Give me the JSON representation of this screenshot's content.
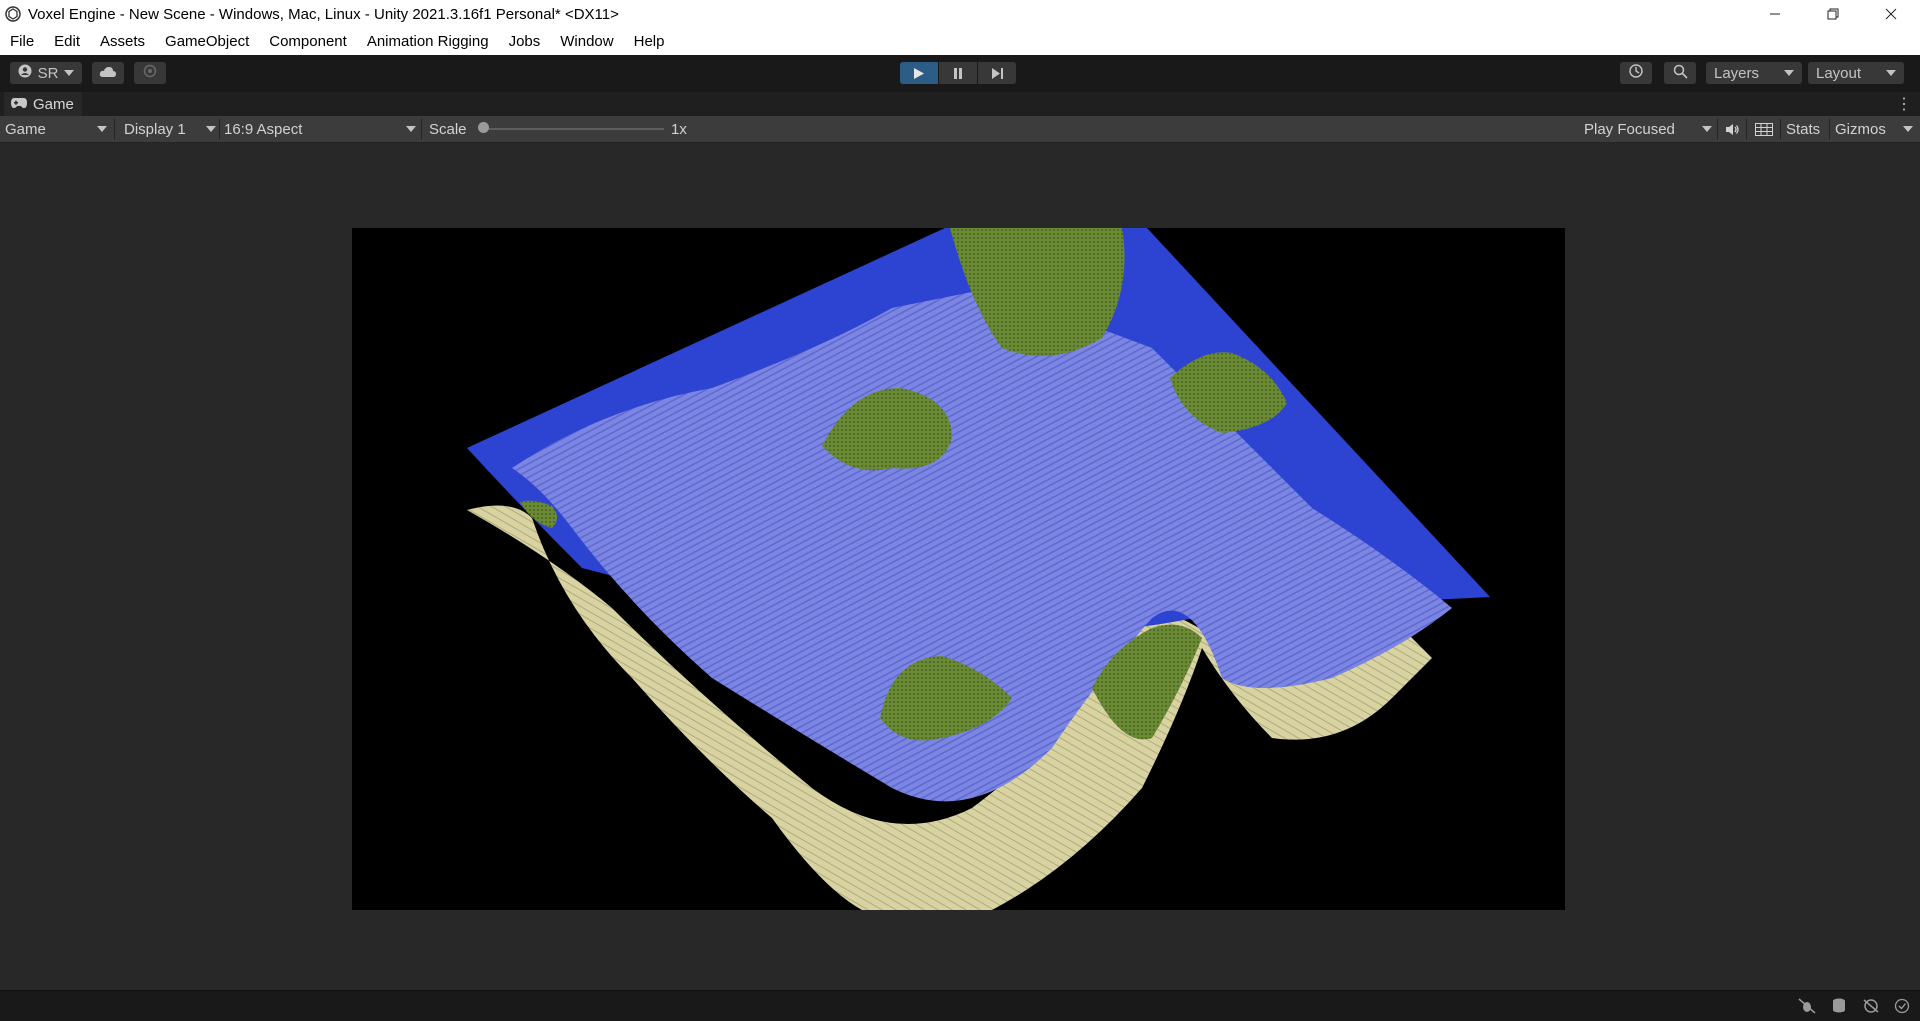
{
  "window": {
    "title": "Voxel Engine - New Scene - Windows, Mac, Linux - Unity 2021.3.16f1 Personal* <DX11>",
    "controls": [
      "minimize-icon",
      "restore-icon",
      "close-icon"
    ]
  },
  "menu": [
    "File",
    "Edit",
    "Assets",
    "GameObject",
    "Component",
    "Animation Rigging",
    "Jobs",
    "Window",
    "Help"
  ],
  "toolbar": {
    "account_label": "SR",
    "layers_label": "Layers",
    "layout_label": "Layout",
    "play_active": true,
    "accent": "#2c5d87"
  },
  "tab": {
    "label": "Game"
  },
  "gamebar": {
    "mode": "Game",
    "display": "Display 1",
    "aspect": "16:9 Aspect",
    "scale_label": "Scale",
    "scale_value": "1x",
    "scale_fraction": 0,
    "play_focused": "Play Focused",
    "stats": "Stats",
    "gizmos": "Gizmos"
  },
  "scene_colors": {
    "water": "#2d44d2",
    "terrain_sand": "#d8d3a0",
    "grass": "#6b8a35",
    "sky": "#000000"
  }
}
